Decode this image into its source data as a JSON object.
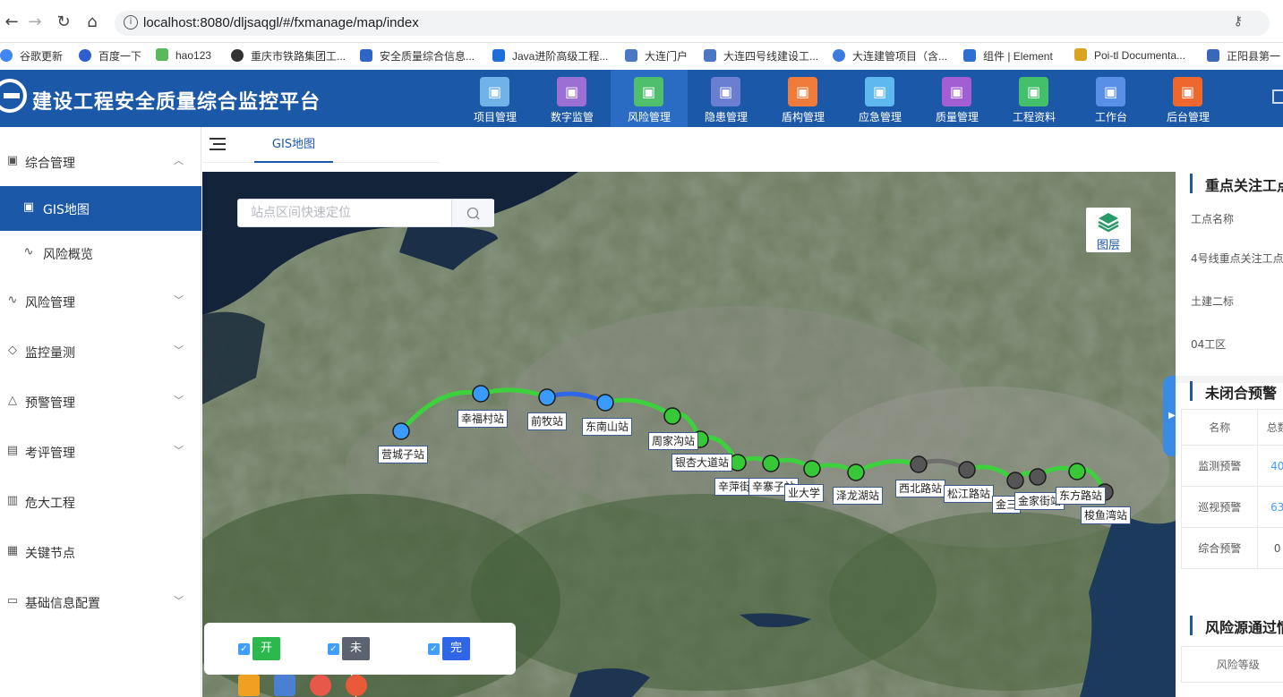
{
  "browser": {
    "url": "localhost:8080/dljsaqgl/#/fxmanage/map/index",
    "bookmarks": [
      "谷歌更新",
      "百度一下",
      "hao123",
      "重庆市铁路集团工...",
      "安全质量综合信息...",
      "Java进阶高级工程...",
      "大连门户",
      "大连四号线建设工...",
      "大连建管项目（含...",
      "组件 | Element",
      "Poi-tl Documenta...",
      "正阳县第一"
    ]
  },
  "app": {
    "title": "建设工程安全质量综合监控平台",
    "modules": [
      {
        "label": "项目管理",
        "icon": "people-icon",
        "color": "#6fb3e8"
      },
      {
        "label": "数字监管",
        "icon": "cube-icon",
        "color": "#9b6fd4"
      },
      {
        "label": "风险管理",
        "icon": "network-icon",
        "color": "#4fbf6c"
      },
      {
        "label": "隐患管理",
        "icon": "list-box-icon",
        "color": "#6a7fd1"
      },
      {
        "label": "盾构管理",
        "icon": "heart-icon",
        "color": "#f07a3a"
      },
      {
        "label": "应急管理",
        "icon": "pulse-icon",
        "color": "#5fb8f0"
      },
      {
        "label": "质量管理",
        "icon": "monitor-icon",
        "color": "#a45ed4"
      },
      {
        "label": "工程资料",
        "icon": "grid-icon",
        "color": "#45c06a"
      },
      {
        "label": "工作台",
        "icon": "screen-icon",
        "color": "#5a8fe8"
      },
      {
        "label": "后台管理",
        "icon": "menu-list-icon",
        "color": "#f0672e"
      }
    ],
    "active_module": "风险管理"
  },
  "sidebar": {
    "items": [
      {
        "label": "综合管理",
        "icon": "map-icon",
        "chevron": "up"
      },
      {
        "label": "GIS地图",
        "icon": "map-icon",
        "active": true
      },
      {
        "label": "风险概览",
        "icon": "pulse-icon"
      },
      {
        "label": "风险管理",
        "icon": "pulse-icon",
        "chevron": "down"
      },
      {
        "label": "监控量测",
        "icon": "ruler-icon",
        "chevron": "down"
      },
      {
        "label": "预警管理",
        "icon": "warning-icon",
        "chevron": "down"
      },
      {
        "label": "考评管理",
        "icon": "form-icon",
        "chevron": "down"
      },
      {
        "label": "危大工程",
        "icon": "bar-chart-icon"
      },
      {
        "label": "关键节点",
        "icon": "calendar-icon"
      },
      {
        "label": "基础信息配置",
        "icon": "code-box-icon",
        "chevron": "down"
      }
    ]
  },
  "tabs": {
    "active": "GIS地图"
  },
  "map": {
    "search_placeholder": "站点区间快速定位",
    "layers_label": "图层",
    "stations": [
      {
        "name": "营城子站",
        "status": "open"
      },
      {
        "name": "幸福村站",
        "status": "open"
      },
      {
        "name": "前牧站",
        "status": "open"
      },
      {
        "name": "东南山站",
        "status": "open"
      },
      {
        "name": "周家沟站",
        "status": "started"
      },
      {
        "name": "银杏大道站",
        "status": "started"
      },
      {
        "name": "辛萍街站",
        "status": "started"
      },
      {
        "name": "辛寨子站",
        "status": "started"
      },
      {
        "name": "工业大学站",
        "status": "started"
      },
      {
        "name": "泽龙湖站",
        "status": "started"
      },
      {
        "name": "西北路站",
        "status": "not-started"
      },
      {
        "name": "松江路站",
        "status": "not-started"
      },
      {
        "name": "金三角站",
        "status": "not-started"
      },
      {
        "name": "金家街站",
        "status": "not-started"
      },
      {
        "name": "东方路站",
        "status": "started"
      },
      {
        "name": "梭鱼湾站",
        "status": "not-started"
      }
    ],
    "station_label_text": {
      "营城子站": "营城子站",
      "幸福村站": "幸福村站",
      "前牧站": "前牧站",
      "东南山站": "东南山站",
      "周家沟站": "周家沟站",
      "银杏大道站": "银杏大道站",
      "辛萍街站": "辛萍街",
      "辛寨子站": "辛寨子站",
      "工业大学站": "业大学",
      "泽龙湖站": "泽龙湖站",
      "西北路站": "西北路站",
      "松江路站": "松江路站",
      "金三角站": "金三",
      "金家街站": "金家街站",
      "东方路站": "东方路站",
      "梭鱼湾站": "梭鱼湾站"
    },
    "legend": [
      {
        "label": "开工",
        "color": "#2db84d",
        "checked": true
      },
      {
        "label": "未开工",
        "color": "#5b6270",
        "checked": true
      },
      {
        "label": "完工",
        "color": "#2f66e8",
        "checked": true
      }
    ],
    "colors": {
      "open": "#3a9bff",
      "started": "#37c837",
      "not-started": "#555555",
      "line-green": "#3dd23d",
      "line-blue": "#2f66e8",
      "line-gray": "#6e6e6e"
    }
  },
  "panel": {
    "focus_title": "重点关注工点",
    "focus_name_label": "工点名称",
    "focus_rows": [
      "4号线重点关注工点",
      "土建二标",
      "04工区"
    ],
    "warning_title": "未闭合预警",
    "warning_headers": [
      "名称",
      "总数"
    ],
    "warning_rows": [
      {
        "name": "监测预警",
        "total": "40"
      },
      {
        "name": "巡视预警",
        "total": "63"
      },
      {
        "name": "综合预警",
        "total": "0"
      }
    ],
    "risk_title": "风险源通过情",
    "risk_header": "风险等级"
  }
}
